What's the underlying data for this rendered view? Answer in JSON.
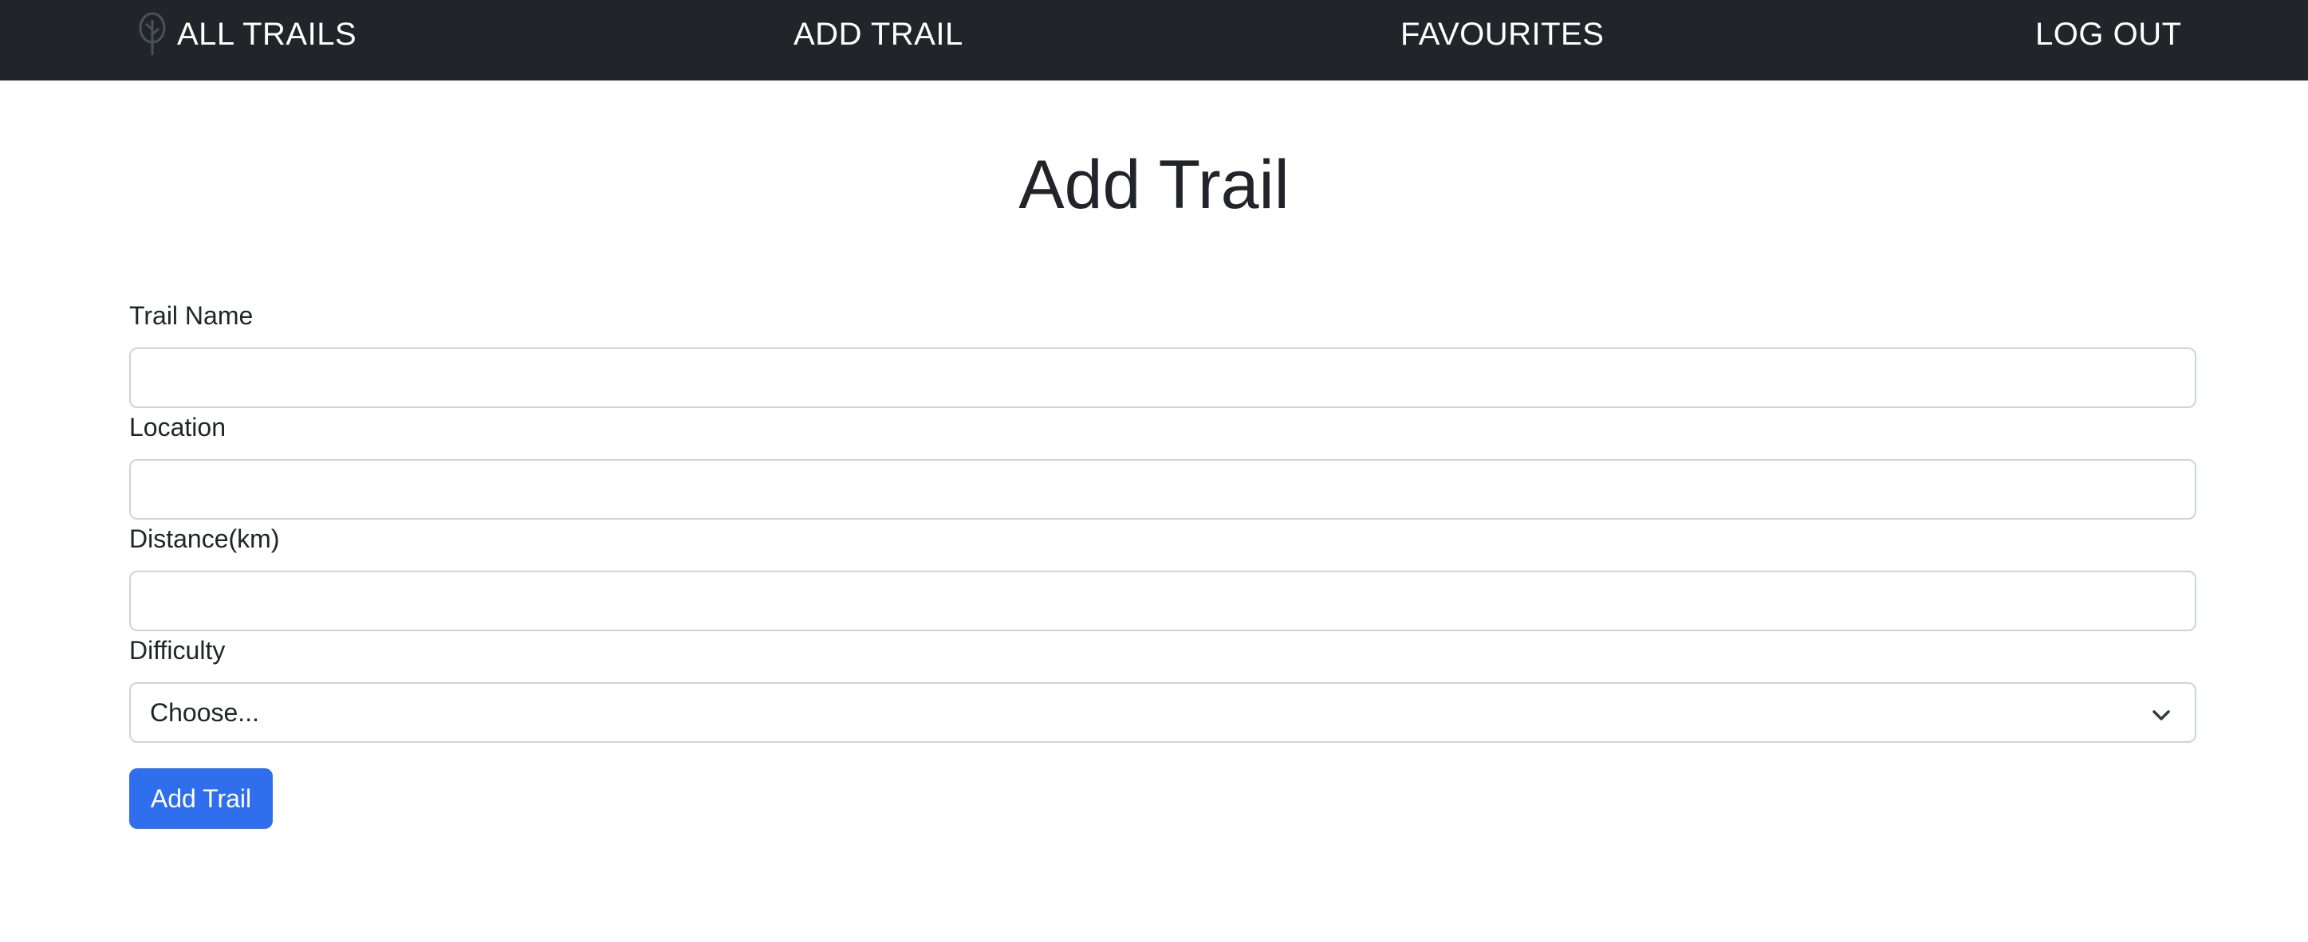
{
  "nav": {
    "brand_icon": "tree-icon",
    "brand_label": "ALL TRAILS",
    "add_trail_label": "ADD TRAIL",
    "favourites_label": "FAVOURITES",
    "logout_label": "LOG OUT"
  },
  "page": {
    "title": "Add Trail"
  },
  "form": {
    "trail_name": {
      "label": "Trail Name",
      "value": "",
      "placeholder": ""
    },
    "location": {
      "label": "Location",
      "value": "",
      "placeholder": ""
    },
    "distance": {
      "label": "Distance(km)",
      "value": "",
      "placeholder": ""
    },
    "difficulty": {
      "label": "Difficulty",
      "selected": "Choose..."
    },
    "submit_label": "Add Trail"
  },
  "colors": {
    "navbar_bg": "#212529",
    "primary": "#2f6fed",
    "border": "#cfd4da",
    "text": "#212529"
  }
}
